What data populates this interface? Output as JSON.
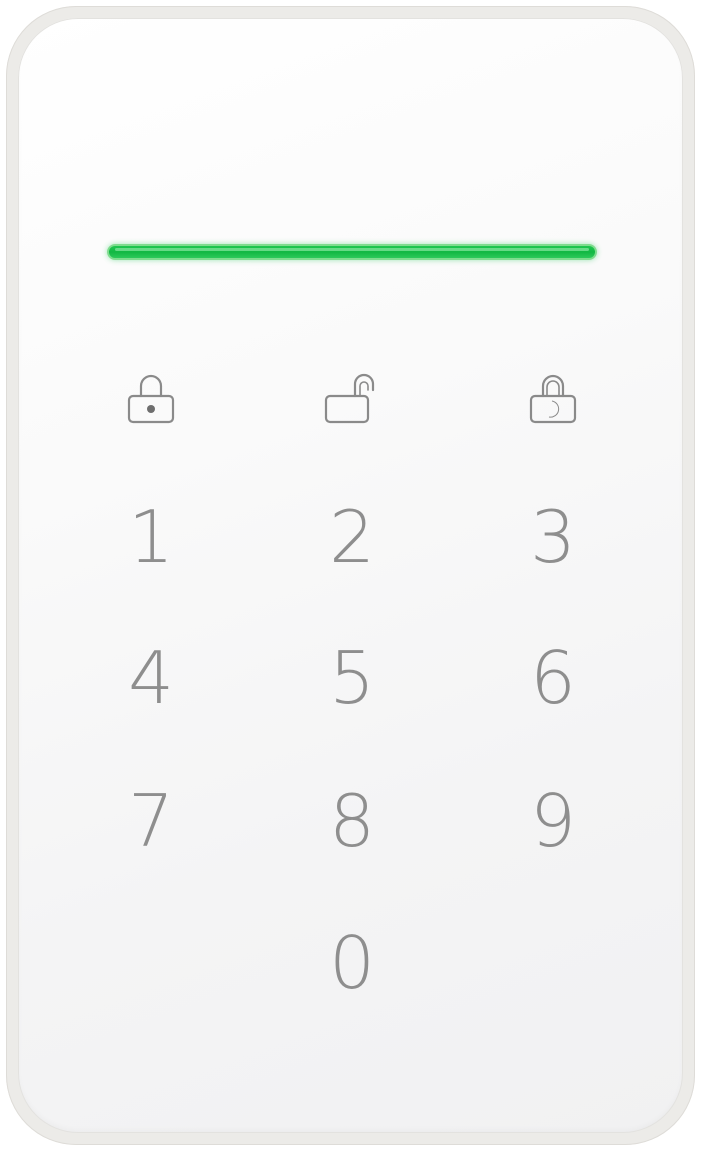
{
  "device": {
    "status_led": {
      "state": "on",
      "color": "#16c048"
    }
  },
  "mode_buttons": [
    {
      "id": "arm",
      "icon": "lock-closed-icon"
    },
    {
      "id": "disarm",
      "icon": "lock-open-icon"
    },
    {
      "id": "night",
      "icon": "lock-moon-icon"
    }
  ],
  "keypad": {
    "digits": [
      "1",
      "2",
      "3",
      "4",
      "5",
      "6",
      "7",
      "8",
      "9",
      "0"
    ]
  },
  "colors": {
    "digit": "#8e8e8e",
    "icon": "#8a8a8a",
    "frame": "#ecebe8",
    "face": "#f7f7f7"
  }
}
